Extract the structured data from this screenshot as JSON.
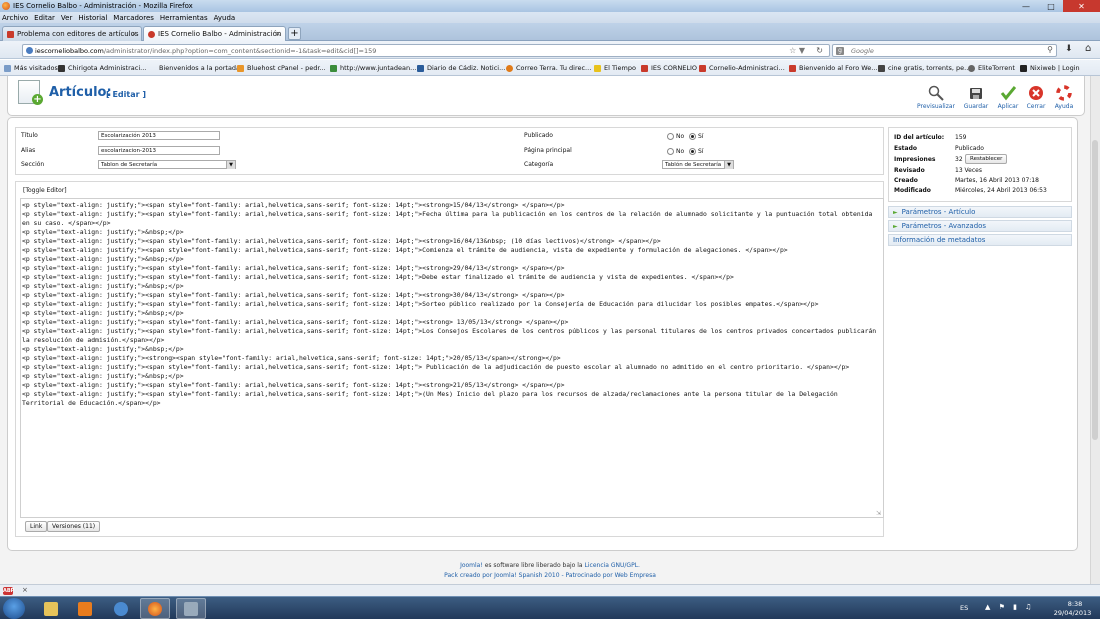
{
  "window": {
    "title": "IES Cornelio Balbo - Administración - Mozilla Firefox"
  },
  "menu": [
    "Archivo",
    "Editar",
    "Ver",
    "Historial",
    "Marcadores",
    "Herramientas",
    "Ayuda"
  ],
  "tabs": [
    {
      "label": "Problema con editores de artículos - ...",
      "active": false
    },
    {
      "label": "IES Cornelio Balbo - Administración",
      "active": true
    }
  ],
  "url": {
    "host": "iescorneliobalbo.com",
    "path": "/administrator/index.php?option=com_content&sectionid=-1&task=edit&cid[]=159"
  },
  "search": {
    "placeholder": "Google"
  },
  "bookmarks": [
    "Más visitados",
    "Chirigota Administraci...",
    "Bienvenidos a la portada",
    "Bluehost cPanel - pedr...",
    "http://www.juntadean...",
    "Diario de Cádiz. Notici...",
    "Correo Terra. Tu direc...",
    "El Tiempo",
    "IES CORNELIO",
    "Cornelio-Administraci...",
    "Bienvenido al Foro We...",
    "cine gratis, torrents, pe...",
    "EliteTorrent",
    "Nixiweb | Login"
  ],
  "header": {
    "title": "Artículo:",
    "mode": "[ Editar ]"
  },
  "toolbar": {
    "preview": "Previsualizar",
    "save": "Guardar",
    "apply": "Aplicar",
    "close": "Cerrar",
    "help": "Ayuda"
  },
  "form": {
    "title_label": "Título",
    "title_value": "Escolarización 2013",
    "alias_label": "Alias",
    "alias_value": "escolarizacion-2013",
    "section_label": "Sección",
    "section_value": "Tablon de Secretaría",
    "published_label": "Publicado",
    "frontpage_label": "Página principal",
    "category_label": "Categoría",
    "category_value": "Tablón de Secretaría",
    "no": "No",
    "yes": "Sí"
  },
  "editor": {
    "toggle": "[Toggle Editor]",
    "lines": [
      "<p style=\"text-align: justify;\"><span style=\"font-family: arial,helvetica,sans-serif; font-size: 14pt;\"><strong>15/04/13</strong> </span></p>",
      "<p style=\"text-align: justify;\"><span style=\"font-family: arial,helvetica,sans-serif; font-size: 14pt;\">Fecha última para la publicación en los centros de la relación de alumnado solicitante y la puntuación total obtenida en su caso. </span></p>",
      "<p style=\"text-align: justify;\">&nbsp;</p>",
      "<p style=\"text-align: justify;\"><span style=\"font-family: arial,helvetica,sans-serif; font-size: 14pt;\"><strong>16/04/13&nbsp; (10 días lectivos)</strong> </span></p>",
      "<p style=\"text-align: justify;\"><span style=\"font-family: arial,helvetica,sans-serif; font-size: 14pt;\">Comienza el trámite de audiencia, vista de expediente y formulación de alegaciones. </span></p>",
      "<p style=\"text-align: justify;\">&nbsp;</p>",
      "<p style=\"text-align: justify;\"><span style=\"font-family: arial,helvetica,sans-serif; font-size: 14pt;\"><strong>29/04/13</strong> </span></p>",
      "<p style=\"text-align: justify;\"><span style=\"font-family: arial,helvetica,sans-serif; font-size: 14pt;\">Debe estar finalizado el trámite de audiencia y vista de expedientes. </span></p>",
      "<p style=\"text-align: justify;\">&nbsp;</p>",
      "<p style=\"text-align: justify;\"><span style=\"font-family: arial,helvetica,sans-serif; font-size: 14pt;\"><strong>30/04/13</strong> </span></p>",
      "<p style=\"text-align: justify;\"><span style=\"font-family: arial,helvetica,sans-serif; font-size: 14pt;\">Sorteo público realizado por la Consejería de Educación para dilucidar los posibles empates.</span></p>",
      "<p style=\"text-align: justify;\">&nbsp;</p>",
      "<p style=\"text-align: justify;\"><span style=\"font-family: arial,helvetica,sans-serif; font-size: 14pt;\"><strong> 13/05/13</strong> </span></p>",
      "<p style=\"text-align: justify;\"><span style=\"font-family: arial,helvetica,sans-serif; font-size: 14pt;\">Los Consejos Escolares de los centros públicos y las personal titulares de los centros privados concertados publicarán la resolución de admisión.</span></p>",
      "<p style=\"text-align: justify;\">&nbsp;</p>",
      "<p style=\"text-align: justify;\"><strong><span style=\"font-family: arial,helvetica,sans-serif; font-size: 14pt;\">20/05/13</span></strong></p>",
      "<p style=\"text-align: justify;\"><span style=\"font-family: arial,helvetica,sans-serif; font-size: 14pt;\"> Publicación de la adjudicación de puesto escolar al alumnado no admitido en el centro prioritario. </span></p>",
      "<p style=\"text-align: justify;\">&nbsp;</p>",
      "<p style=\"text-align: justify;\"><span style=\"font-family: arial,helvetica,sans-serif; font-size: 14pt;\"><strong>21/05/13</strong> </span></p>",
      "<p style=\"text-align: justify;\"><span style=\"font-family: arial,helvetica,sans-serif; font-size: 14pt;\">(Un Mes) Inicio del plazo para los recursos de alzada/reclamaciones ante la persona titular de la Delegación Territorial de Educación.</span></p>"
    ],
    "link_btn": "Link",
    "versions_btn": "Versiones (11)"
  },
  "info": {
    "id_label": "ID del artículo:",
    "id_value": "159",
    "state_label": "Estado",
    "state_value": "Publicado",
    "hits_label": "Impresiones",
    "hits_value": "32",
    "reset_btn": "Restablecer",
    "revised_label": "Revisado",
    "revised_value": "13 Veces",
    "created_label": "Creado",
    "created_value": "Martes, 16 Abril 2013 07:18",
    "modified_label": "Modificado",
    "modified_value": "Miércoles, 24 Abril 2013 06:53"
  },
  "accordion": [
    "Parámetros - Artículo",
    "Parámetros - Avanzados",
    "Información de metadatos"
  ],
  "footer": {
    "line1_a": "Joomla!",
    "line1_b": " es software libre liberado bajo la ",
    "line1_c": "Licencia GNU/GPL.",
    "line2": "Pack creado por Joomla! Spanish 2010 - Patrocinado por Web Empresa"
  },
  "taskbar": {
    "lang": "ES",
    "time": "8:38",
    "date": "29/04/2013"
  },
  "colors": {
    "accent": "#1f5fa8",
    "close_btn": "#c7382e",
    "green": "#5aa832"
  }
}
